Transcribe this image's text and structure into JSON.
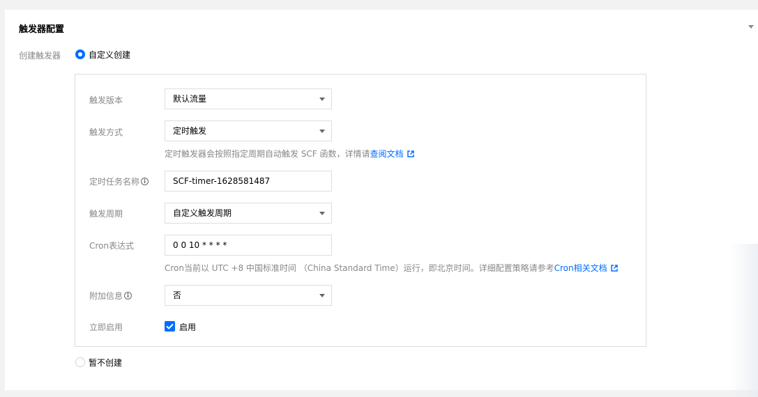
{
  "section": {
    "title": "触发器配置"
  },
  "create_trigger": {
    "label": "创建触发器",
    "options": {
      "custom": "自定义创建",
      "none": "暂不创建"
    },
    "selected": "custom"
  },
  "form": {
    "version": {
      "label": "触发版本",
      "value": "默认流量"
    },
    "method": {
      "label": "触发方式",
      "value": "定时触发",
      "help_text": "定时触发器会按照指定周期自动触发 SCF 函数，详情请",
      "help_link": "查阅文档"
    },
    "task_name": {
      "label": "定时任务名称",
      "value": "SCF-timer-1628581487"
    },
    "period": {
      "label": "触发周期",
      "value": "自定义触发周期"
    },
    "cron": {
      "label": "Cron表达式",
      "value": "0 0 10 * * * *",
      "help_text": "Cron当前以 UTC +8 中国标准时间 （China Standard Time）运行，即北京时间。详细配置策略请参考",
      "help_link": "Cron相关文档"
    },
    "extra": {
      "label": "附加信息",
      "value": "否"
    },
    "enable": {
      "label": "立即启用",
      "checkbox_label": "启用",
      "checked": true
    }
  },
  "colors": {
    "accent": "#006eff",
    "label": "#888888",
    "border": "#dddddd"
  },
  "icons": {
    "info": "info-icon",
    "external_link": "external-link-icon",
    "caret": "chevron-down-icon",
    "check": "check-icon"
  }
}
